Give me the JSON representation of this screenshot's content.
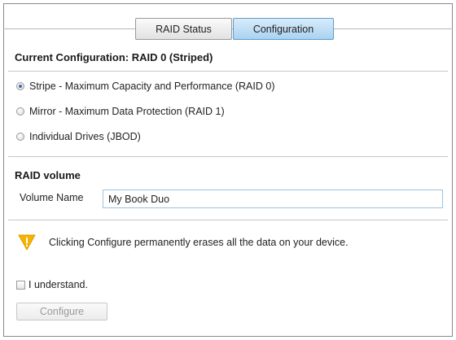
{
  "tabs": [
    {
      "label": "RAID Status",
      "active": false
    },
    {
      "label": "Configuration",
      "active": true
    }
  ],
  "current_configuration": "Current Configuration:  RAID 0 (Striped)",
  "raid_options": [
    {
      "label": "Stripe - Maximum Capacity and Performance (RAID 0)",
      "selected": true
    },
    {
      "label": "Mirror - Maximum Data Protection (RAID 1)",
      "selected": false
    },
    {
      "label": "Individual Drives (JBOD)",
      "selected": false
    }
  ],
  "raid_volume": {
    "heading": "RAID volume",
    "name_label": "Volume Name",
    "name_value": "My Book Duo"
  },
  "warning": {
    "icon": "warning-icon",
    "text": "Clicking Configure permanently erases all the data on your device.",
    "color": "#f5b400"
  },
  "acknowledge": {
    "label": "I understand.",
    "checked": false
  },
  "configure_button": {
    "label": "Configure",
    "enabled": false
  },
  "colors": {
    "active_tab": "#a9d2f1",
    "input_border": "#9cc3e6"
  }
}
